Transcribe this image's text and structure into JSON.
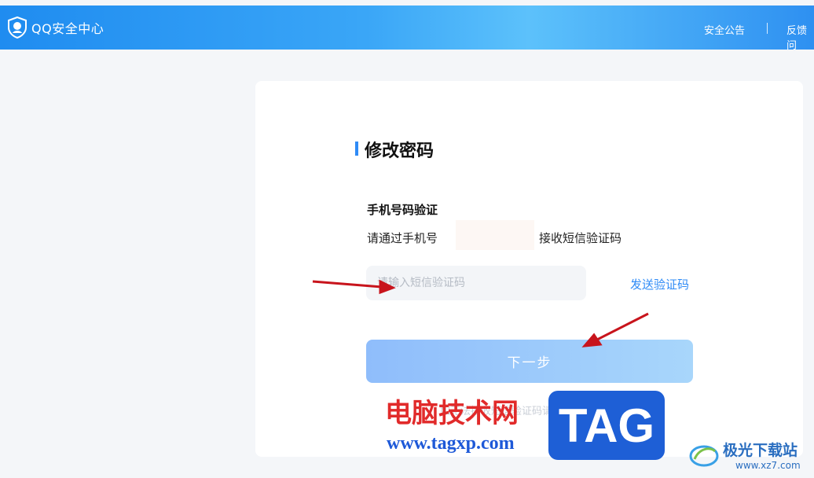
{
  "header": {
    "logo_text": "QQ安全中心",
    "nav": [
      {
        "label": "安全公告"
      },
      {
        "label": "反馈问"
      }
    ]
  },
  "card": {
    "title": "修改密码",
    "section_title": "手机号码验证",
    "instruction_prefix": "请通过手机号",
    "instruction_suffix": "接收短信验证码",
    "code_input": {
      "placeholder": "请输入短信验证码",
      "value": ""
    },
    "send_code_label": "发送验证码",
    "next_label": "下一步",
    "faint_text": "如无法接收短信验证码请尝试其他方式"
  },
  "watermark": {
    "cn_text": "电脑技术网",
    "url": "www.tagxp.com",
    "tag": "TAG",
    "site2_name": "极光下载站",
    "site2_url": "www.xz7.com"
  },
  "colors": {
    "accent": "#2f8bf6",
    "watermark_red": "#e12a2a",
    "watermark_blue": "#1e5fd6"
  }
}
